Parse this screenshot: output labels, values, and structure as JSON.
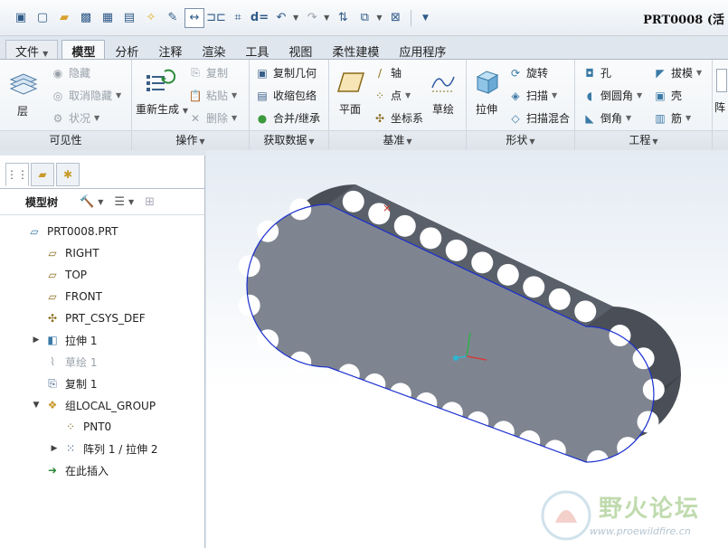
{
  "window": {
    "title": "PRT0008 (活"
  },
  "quick_access": {
    "icons": [
      "new-icon",
      "open-icon",
      "save-icon",
      "save-as-icon",
      "regenerate-icon",
      "idea-icon",
      "edit-icon",
      "dimension-icon",
      "mirror-icon",
      "sketch-icon",
      "d-equals-icon",
      "undo-icon",
      "redo-icon",
      "switch-window-icon",
      "windows-icon",
      "close-window-icon",
      "more-icon"
    ]
  },
  "tabs": [
    {
      "label": "文件",
      "type": "file"
    },
    {
      "label": "模型",
      "type": "active"
    },
    {
      "label": "分析"
    },
    {
      "label": "注释"
    },
    {
      "label": "渲染"
    },
    {
      "label": "工具"
    },
    {
      "label": "视图"
    },
    {
      "label": "柔性建模"
    },
    {
      "label": "应用程序"
    }
  ],
  "ribbon": {
    "visibility": {
      "label": "可见性",
      "layer": "层",
      "hide": "隐藏",
      "unhide": "取消隐藏",
      "status": "状况"
    },
    "operations": {
      "label": "操作",
      "regenerate": "重新生成",
      "copy": "复制",
      "paste": "粘贴",
      "delete": "删除"
    },
    "get_data": {
      "label": "获取数据",
      "copy_geometry": "复制几何",
      "shrinkwrap": "收缩包络",
      "merge_inherit": "合并/继承"
    },
    "datum": {
      "label": "基准",
      "plane": "平面",
      "axis": "轴",
      "point": "点",
      "csys": "坐标系",
      "sketch": "草绘"
    },
    "shapes": {
      "label": "形状",
      "extrude": "拉伸",
      "revolve": "旋转",
      "sweep": "扫描",
      "swept_blend": "扫描混合"
    },
    "engineering": {
      "label": "工程",
      "hole": "孔",
      "round": "倒圆角",
      "chamfer": "倒角",
      "draft": "拔模",
      "shell": "壳",
      "rib": "筋"
    },
    "edit_partial": "阵"
  },
  "model_tree": {
    "title": "模型树",
    "nodes": [
      {
        "label": "PRT0008.PRT",
        "icon": "part-icon",
        "level": 0,
        "expander": ""
      },
      {
        "label": "RIGHT",
        "icon": "datum-plane-icon",
        "level": 1,
        "expander": ""
      },
      {
        "label": "TOP",
        "icon": "datum-plane-icon",
        "level": 1,
        "expander": ""
      },
      {
        "label": "FRONT",
        "icon": "datum-plane-icon",
        "level": 1,
        "expander": ""
      },
      {
        "label": "PRT_CSYS_DEF",
        "icon": "csys-icon",
        "level": 1,
        "expander": ""
      },
      {
        "label": "拉伸 1",
        "icon": "extrude-icon",
        "level": 1,
        "expander": "▶"
      },
      {
        "label": "草绘 1",
        "icon": "sketch-icon",
        "level": 1,
        "expander": "",
        "dim": true
      },
      {
        "label": "复制 1",
        "icon": "copy-feature-icon",
        "level": 1,
        "expander": ""
      },
      {
        "label": "组LOCAL_GROUP",
        "icon": "group-icon",
        "level": 1,
        "expander": "▼"
      },
      {
        "label": "PNT0",
        "icon": "datum-point-icon",
        "level": 2,
        "expander": ""
      },
      {
        "label": "阵列 1 / 拉伸 2",
        "icon": "pattern-icon",
        "level": 2,
        "expander": "▶"
      },
      {
        "label": "在此插入",
        "icon": "insert-here-icon",
        "level": 1,
        "expander": ""
      }
    ]
  },
  "watermark": {
    "name": "野火论坛",
    "url": "www.proewildfire.cn"
  },
  "colors": {
    "accent": "#2f5a88",
    "model_face": "#7f8590",
    "model_side": "#4a4f57",
    "edge_highlight": "#1a2fcf"
  }
}
